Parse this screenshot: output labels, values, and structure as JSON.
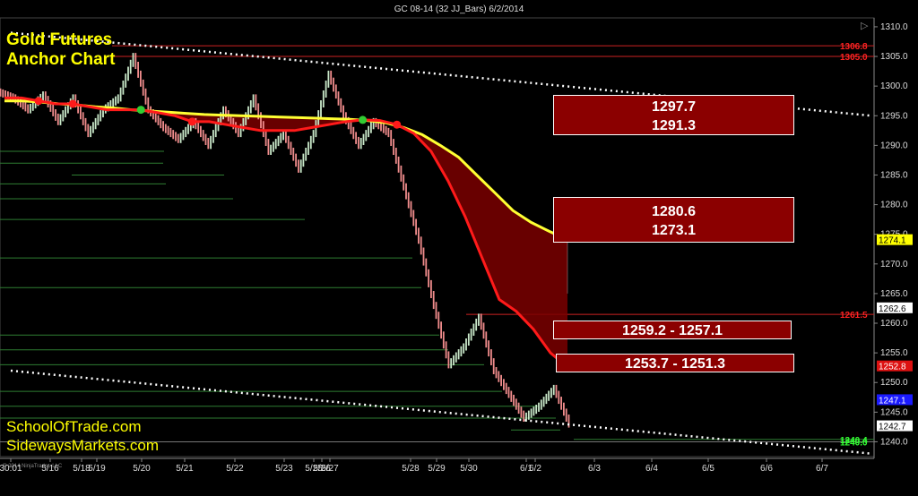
{
  "header": {
    "chart_title": "GC 08-14 (32 JJ_Bars)  6/2/2014"
  },
  "overlay": {
    "title_line1": "Gold Futures",
    "title_line2": "Anchor Chart",
    "site1": "SchoolOfTrade.com",
    "site2": "SidewaysMarkets.com",
    "copyright": "© 2014 NinjaTrader, LLC"
  },
  "zones": {
    "zone1_top": "1297.7",
    "zone1_bottom": "1291.3",
    "zone2_top": "1280.6",
    "zone2_bottom": "1273.1",
    "zone3": "1259.2 - 1257.1",
    "zone4": "1253.7 - 1251.3"
  },
  "colors": {
    "background": "#000000",
    "up_bar": "#c9e8c9",
    "down_bar": "#f08c8c",
    "ema_fast": "#ff1a1a",
    "ema_slow": "#ffff33",
    "ribbon": "#7a0000",
    "zone_fill": "#8b0000",
    "level_line": "#2e7d32",
    "resistance_line": "#cc2222",
    "trend_line": "#ffffff"
  },
  "chart_data": {
    "type": "line",
    "title": "GC 08-14 (32 JJ_Bars)  6/2/2014",
    "xlabel": "",
    "ylabel": "",
    "ylim": [
      1237.5,
      1311.5
    ],
    "grid": false,
    "y_ticks": [
      1240.0,
      1245.0,
      1250.0,
      1255.0,
      1260.0,
      1265.0,
      1270.0,
      1275.0,
      1280.0,
      1285.0,
      1290.0,
      1295.0,
      1300.0,
      1305.0,
      1310.0
    ],
    "x_tick_labels": [
      "30:01",
      "5/16",
      "5/18",
      "5/19",
      "5/20",
      "5/21",
      "5/22",
      "5/23",
      "5/25",
      "5/26",
      "5/27",
      "5/28",
      "5/29",
      "5/30",
      "6/1",
      "6/2",
      "6/3",
      "6/4",
      "6/5",
      "6/6",
      "6/7"
    ],
    "series": [
      {
        "name": "price_close",
        "values": [
          1298.0,
          1296.0,
          1298.5,
          1294.0,
          1298.0,
          1292.0,
          1296.0,
          1298.0,
          1305.0,
          1296.0,
          1293.0,
          1291.0,
          1294.0,
          1290.0,
          1296.0,
          1292.0,
          1298.0,
          1289.0,
          1292.0,
          1286.0,
          1292.0,
          1302.0,
          1295.0,
          1290.0,
          1294.0,
          1292.0,
          1283.0,
          1274.0,
          1263.0,
          1253.0,
          1256.0,
          1261.0,
          1252.0,
          1248.0,
          1244.0,
          1246.0,
          1249.0,
          1243.0
        ]
      },
      {
        "name": "ema_fast",
        "values": [
          1298.0,
          1298.0,
          1297.5,
          1297.0,
          1297.0,
          1296.5,
          1296.0,
          1296.0,
          1296.0,
          1295.5,
          1295.0,
          1294.0,
          1294.0,
          1293.5,
          1293.0,
          1292.5,
          1292.5,
          1292.5,
          1293.0,
          1293.5,
          1294.0,
          1294.3,
          1294.2,
          1293.5,
          1292.0,
          1289.0,
          1284.0,
          1278.0,
          1271.0,
          1264.0,
          1262.0,
          1259.0,
          1255.0,
          1252.6
        ]
      },
      {
        "name": "ema_slow",
        "values": [
          1297.5,
          1297.5,
          1297.3,
          1297.0,
          1296.8,
          1296.5,
          1296.3,
          1296.0,
          1295.8,
          1295.6,
          1295.4,
          1295.2,
          1295.1,
          1295.0,
          1294.9,
          1294.8,
          1294.7,
          1294.6,
          1294.5,
          1294.4,
          1294.2,
          1293.8,
          1293.0,
          1291.8,
          1290.0,
          1288.0,
          1285.0,
          1282.0,
          1279.0,
          1277.0,
          1275.5,
          1274.1
        ]
      }
    ],
    "horizontal_levels": [
      1306.8,
      1305.0,
      1261.5,
      1240.4,
      1240.0
    ],
    "price_markers": [
      {
        "label": "1306.8",
        "value": 1306.8
      },
      {
        "label": "1305.0",
        "value": 1305.0
      },
      {
        "label": "1274.1",
        "value": 1274.1
      },
      {
        "label": "1262.6",
        "value": 1262.6
      },
      {
        "label": "1261.5",
        "value": 1261.5
      },
      {
        "label": "1252.8",
        "value": 1252.8
      },
      {
        "label": "1247.1",
        "value": 1247.1
      },
      {
        "label": "1242.7",
        "value": 1242.7
      },
      {
        "label": "1240.4",
        "value": 1240.4
      },
      {
        "label": "1240.0",
        "value": 1240.0
      }
    ],
    "trend_lines": [
      {
        "from": [
          "30:01",
          1309.0
        ],
        "to": [
          "6/7",
          1295.0
        ]
      },
      {
        "from": [
          "30:01",
          1252.0
        ],
        "to": [
          "6/7",
          1238.0
        ]
      }
    ],
    "annotations": [
      "1297.7",
      "1291.3",
      "1280.6",
      "1273.1",
      "1259.2 - 1257.1",
      "1253.7 - 1251.3"
    ]
  }
}
